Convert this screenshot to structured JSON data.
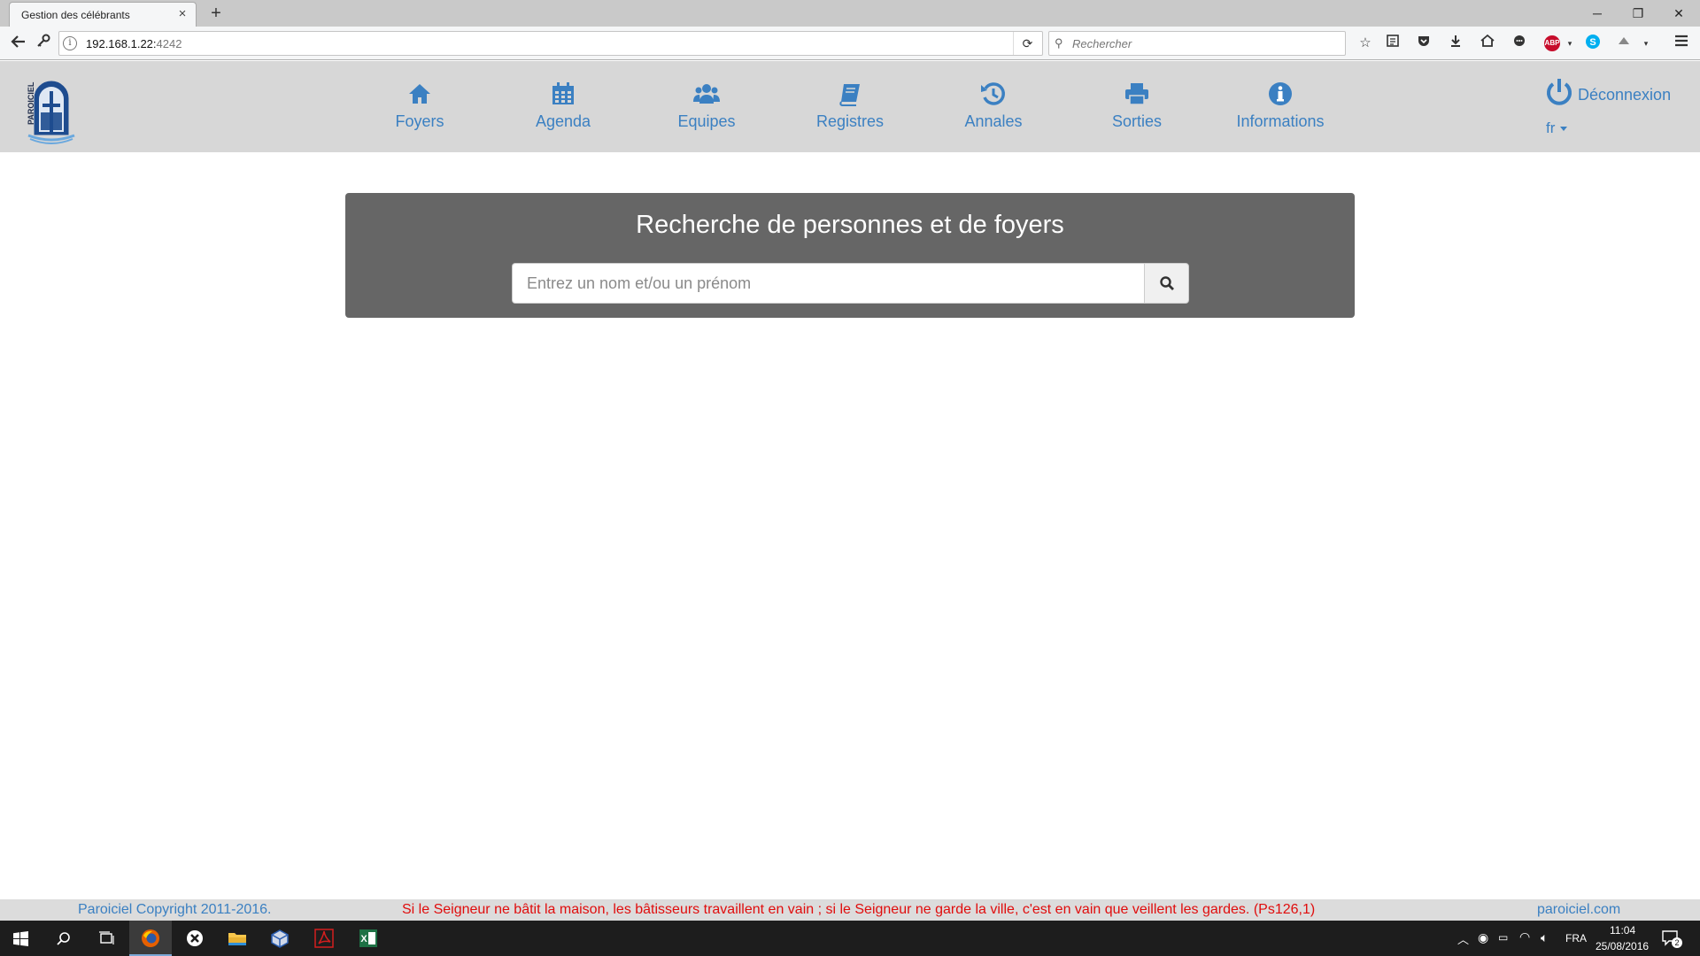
{
  "browser": {
    "tab_title": "Gestion des célébrants",
    "tab_close": "×",
    "new_tab": "+",
    "url_host": "192.168.1.22:",
    "url_port": "4242",
    "search_placeholder": "Rechercher",
    "abp_label": "ABP",
    "window_controls": {
      "minimize": "─",
      "restore": "❐",
      "close": "✕"
    }
  },
  "app": {
    "logo_text": "PAROICIEL",
    "nav_items": [
      {
        "label": "Foyers",
        "icon": "home-icon"
      },
      {
        "label": "Agenda",
        "icon": "calendar-icon"
      },
      {
        "label": "Equipes",
        "icon": "users-icon"
      },
      {
        "label": "Registres",
        "icon": "book-icon"
      },
      {
        "label": "Annales",
        "icon": "history-icon"
      },
      {
        "label": "Sorties",
        "icon": "print-icon"
      },
      {
        "label": "Informations",
        "icon": "info-icon"
      }
    ],
    "logout_label": "Déconnexion",
    "language": "fr",
    "accent_color": "#3b80c2"
  },
  "search": {
    "title": "Recherche de personnes et de foyers",
    "placeholder": "Entrez un nom et/ou un prénom",
    "value": ""
  },
  "footer": {
    "copyright": "Paroiciel Copyright 2011-2016.",
    "verse": "Si le Seigneur ne bâtit la maison, les bâtisseurs travaillent en vain ; si le Seigneur ne garde la ville, c'est en vain que veillent les gardes. (Ps126,1)",
    "site": "paroiciel.com",
    "verse_color": "#e00d0d"
  },
  "taskbar": {
    "language": "FRA",
    "time": "11:04",
    "date": "25/08/2016",
    "notifications": "2",
    "excel_glyph": "X"
  }
}
